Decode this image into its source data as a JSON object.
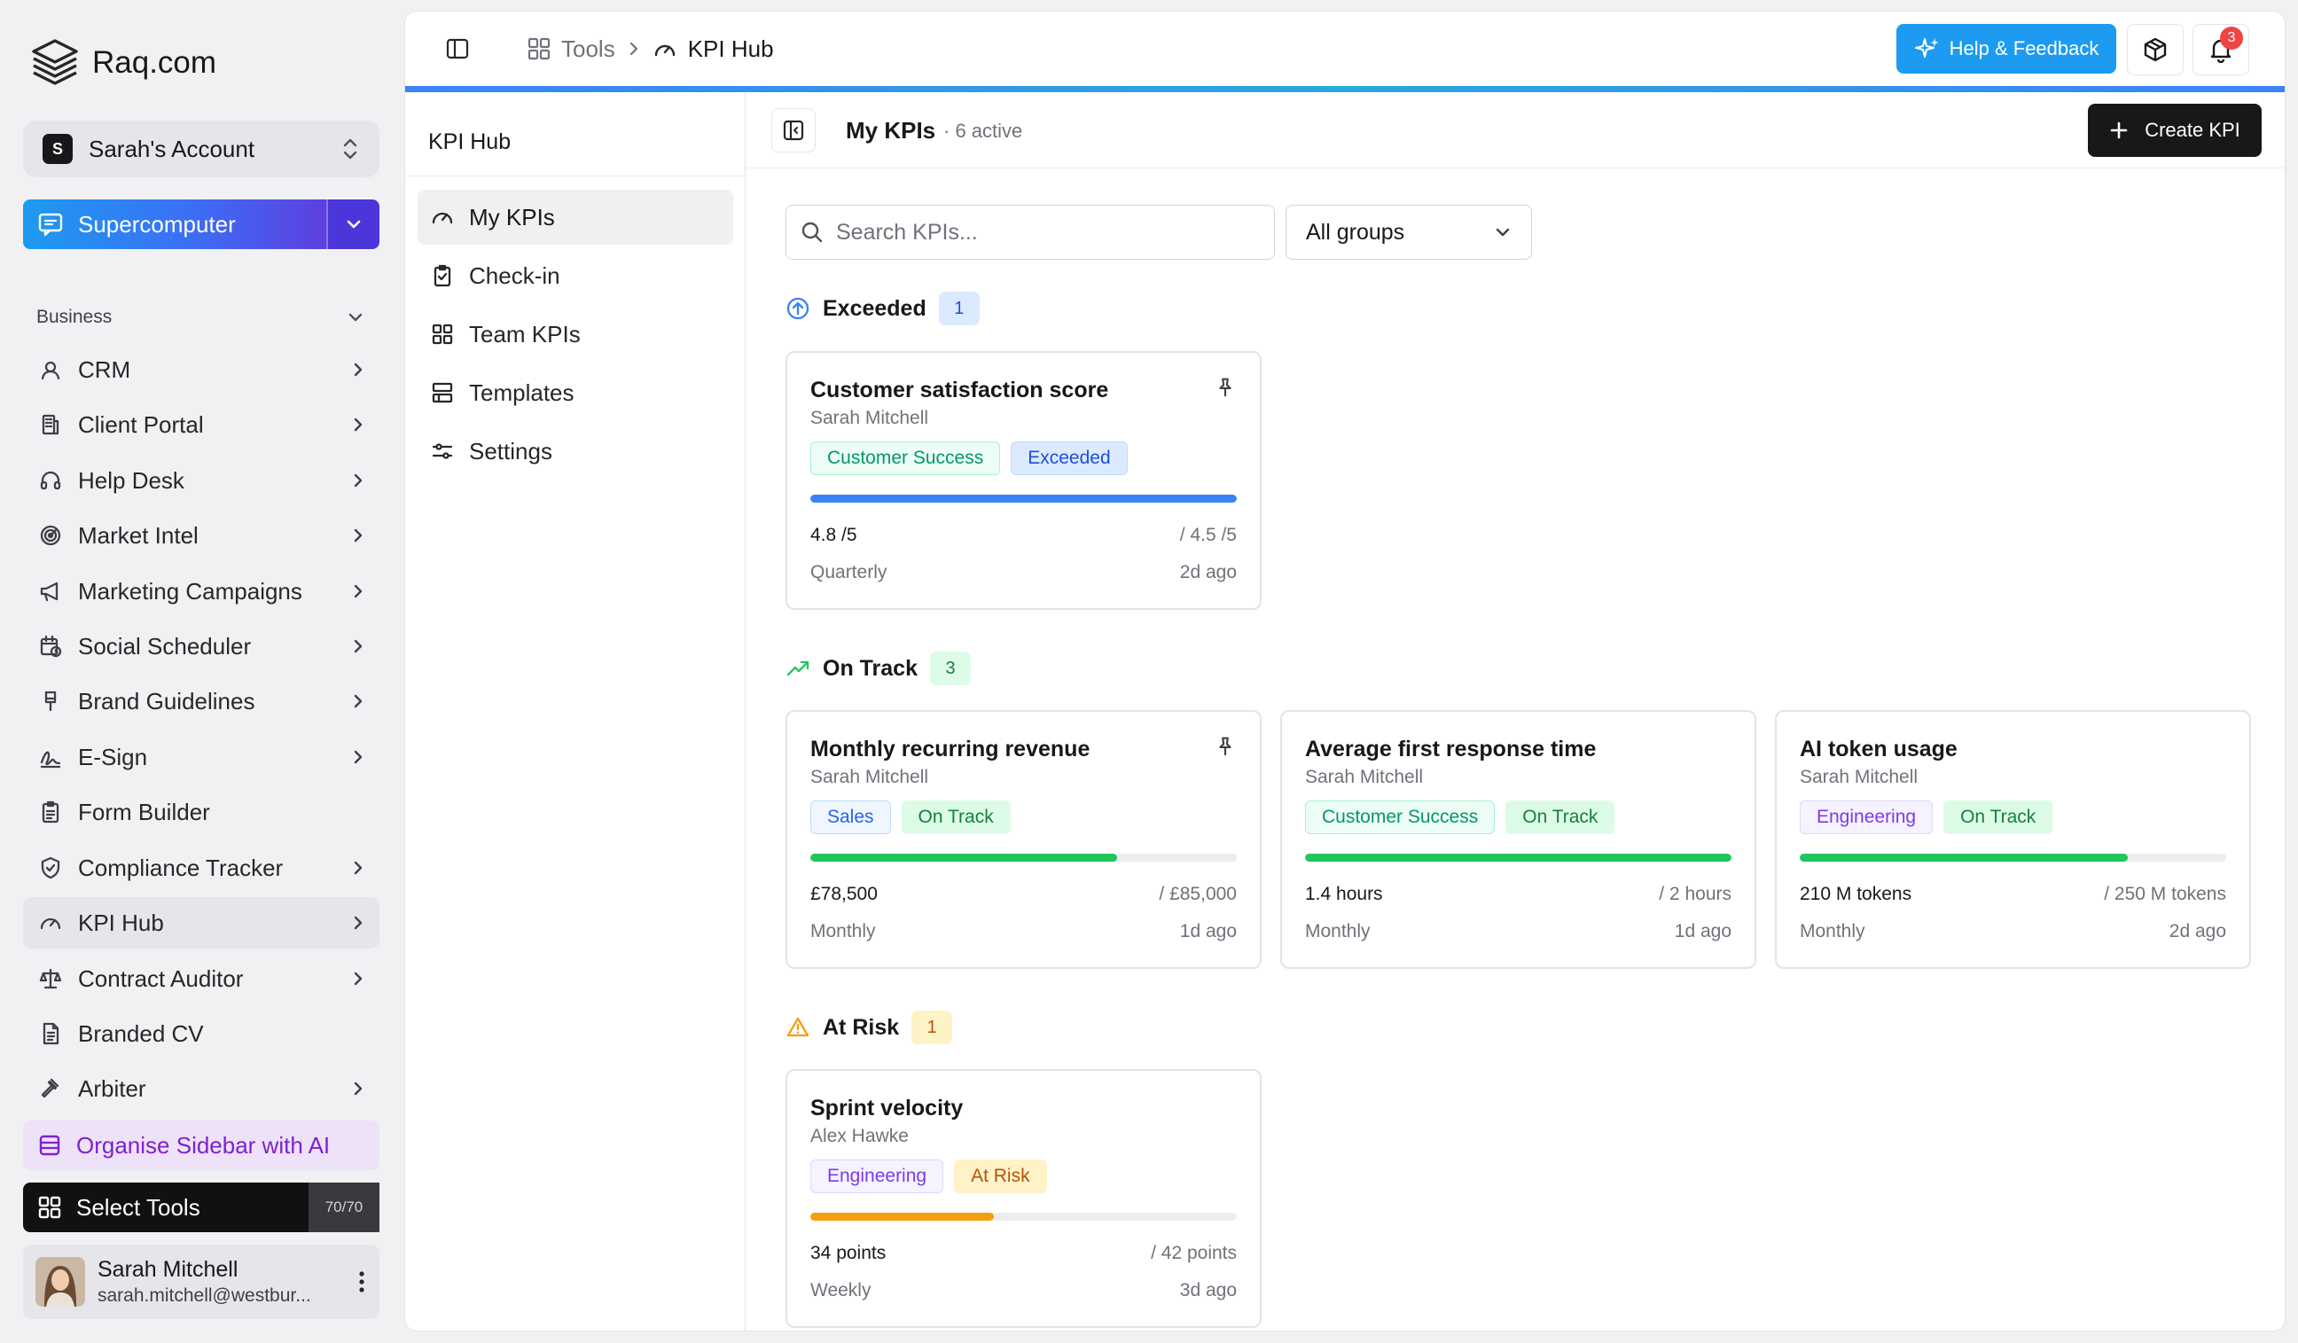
{
  "brand": {
    "name": "Raq.com"
  },
  "account": {
    "initial": "S",
    "name": "Sarah's Account"
  },
  "supercomputer": {
    "label": "Supercomputer"
  },
  "sidebar": {
    "section": "Business",
    "items": [
      {
        "label": "CRM",
        "icon": "user-circle-icon",
        "chevron": true
      },
      {
        "label": "Client Portal",
        "icon": "building-icon",
        "chevron": true
      },
      {
        "label": "Help Desk",
        "icon": "headset-icon",
        "chevron": true
      },
      {
        "label": "Market Intel",
        "icon": "radar-icon",
        "chevron": true
      },
      {
        "label": "Marketing Campaigns",
        "icon": "megaphone-icon",
        "chevron": true
      },
      {
        "label": "Social Scheduler",
        "icon": "calendar-clock-icon",
        "chevron": true
      },
      {
        "label": "Brand Guidelines",
        "icon": "brush-icon",
        "chevron": true
      },
      {
        "label": "E-Sign",
        "icon": "signature-icon",
        "chevron": true
      },
      {
        "label": "Form Builder",
        "icon": "clipboard-icon",
        "chevron": false
      },
      {
        "label": "Compliance Tracker",
        "icon": "shield-check-icon",
        "chevron": true
      },
      {
        "label": "KPI Hub",
        "icon": "gauge-icon",
        "chevron": true,
        "active": true
      },
      {
        "label": "Contract Auditor",
        "icon": "scale-icon",
        "chevron": true
      },
      {
        "label": "Branded CV",
        "icon": "file-text-icon",
        "chevron": false
      },
      {
        "label": "Arbiter",
        "icon": "gavel-icon",
        "chevron": true
      }
    ],
    "organise": "Organise Sidebar with AI",
    "select_tools": {
      "label": "Select Tools",
      "count": "70/70"
    }
  },
  "user": {
    "name": "Sarah Mitchell",
    "email": "sarah.mitchell@westbur..."
  },
  "topbar": {
    "crumb_tools": "Tools",
    "crumb_current": "KPI Hub",
    "help_label": "Help & Feedback",
    "notifications": "3"
  },
  "subnav": {
    "title": "KPI Hub",
    "items": [
      {
        "label": "My KPIs",
        "icon": "gauge-icon",
        "active": true
      },
      {
        "label": "Check-in",
        "icon": "clipboard-check-icon"
      },
      {
        "label": "Team KPIs",
        "icon": "grid-icon"
      },
      {
        "label": "Templates",
        "icon": "template-icon"
      },
      {
        "label": "Settings",
        "icon": "sliders-icon"
      }
    ]
  },
  "content": {
    "title": "My KPIs",
    "subtitle": "· 6 active",
    "create_label": "Create KPI",
    "search_placeholder": "Search KPIs...",
    "group_filter": "All groups"
  },
  "colors": {
    "exceeded": "#3b82f6",
    "on_track": "#22c55e",
    "at_risk": "#f59e0b",
    "accent": "#1d9bf0"
  },
  "groups": [
    {
      "name": "Exceeded",
      "count": "1",
      "icon": "arrow-up-circle-icon",
      "cards": [
        {
          "title": "Customer satisfaction score",
          "owner": "Sarah Mitchell",
          "pinned": true,
          "tags": [
            {
              "label": "Customer Success",
              "kind": "cs"
            },
            {
              "label": "Exceeded",
              "kind": "exceeded"
            }
          ],
          "progress": 1.0,
          "bar_color": "#3b82f6",
          "current": "4.8 /5",
          "target": "/ 4.5 /5",
          "period": "Quarterly",
          "updated": "2d ago"
        }
      ]
    },
    {
      "name": "On Track",
      "count": "3",
      "icon": "trending-up-icon",
      "cards": [
        {
          "title": "Monthly recurring revenue",
          "owner": "Sarah Mitchell",
          "pinned": true,
          "tags": [
            {
              "label": "Sales",
              "kind": "sales"
            },
            {
              "label": "On Track",
              "kind": "ontrack"
            }
          ],
          "progress": 0.72,
          "bar_color": "#22c55e",
          "current": "£78,500",
          "target": "/ £85,000",
          "period": "Monthly",
          "updated": "1d ago"
        },
        {
          "title": "Average first response time",
          "owner": "Sarah Mitchell",
          "pinned": false,
          "tags": [
            {
              "label": "Customer Success",
              "kind": "cs"
            },
            {
              "label": "On Track",
              "kind": "ontrack"
            }
          ],
          "progress": 1.0,
          "bar_color": "#22c55e",
          "current": "1.4 hours",
          "target": "/ 2 hours",
          "period": "Monthly",
          "updated": "1d ago"
        },
        {
          "title": "AI token usage",
          "owner": "Sarah Mitchell",
          "pinned": false,
          "tags": [
            {
              "label": "Engineering",
              "kind": "eng"
            },
            {
              "label": "On Track",
              "kind": "ontrack"
            }
          ],
          "progress": 0.77,
          "bar_color": "#22c55e",
          "current": "210 M tokens",
          "target": "/ 250 M tokens",
          "period": "Monthly",
          "updated": "2d ago"
        }
      ]
    },
    {
      "name": "At Risk",
      "count": "1",
      "icon": "warning-icon",
      "cards": [
        {
          "title": "Sprint velocity",
          "owner": "Alex Hawke",
          "pinned": false,
          "tags": [
            {
              "label": "Engineering",
              "kind": "eng"
            },
            {
              "label": "At Risk",
              "kind": "atrisk"
            }
          ],
          "progress": 0.43,
          "bar_color": "#f59e0b",
          "current": "34 points",
          "target": "/ 42 points",
          "period": "Weekly",
          "updated": "3d ago"
        }
      ]
    }
  ]
}
